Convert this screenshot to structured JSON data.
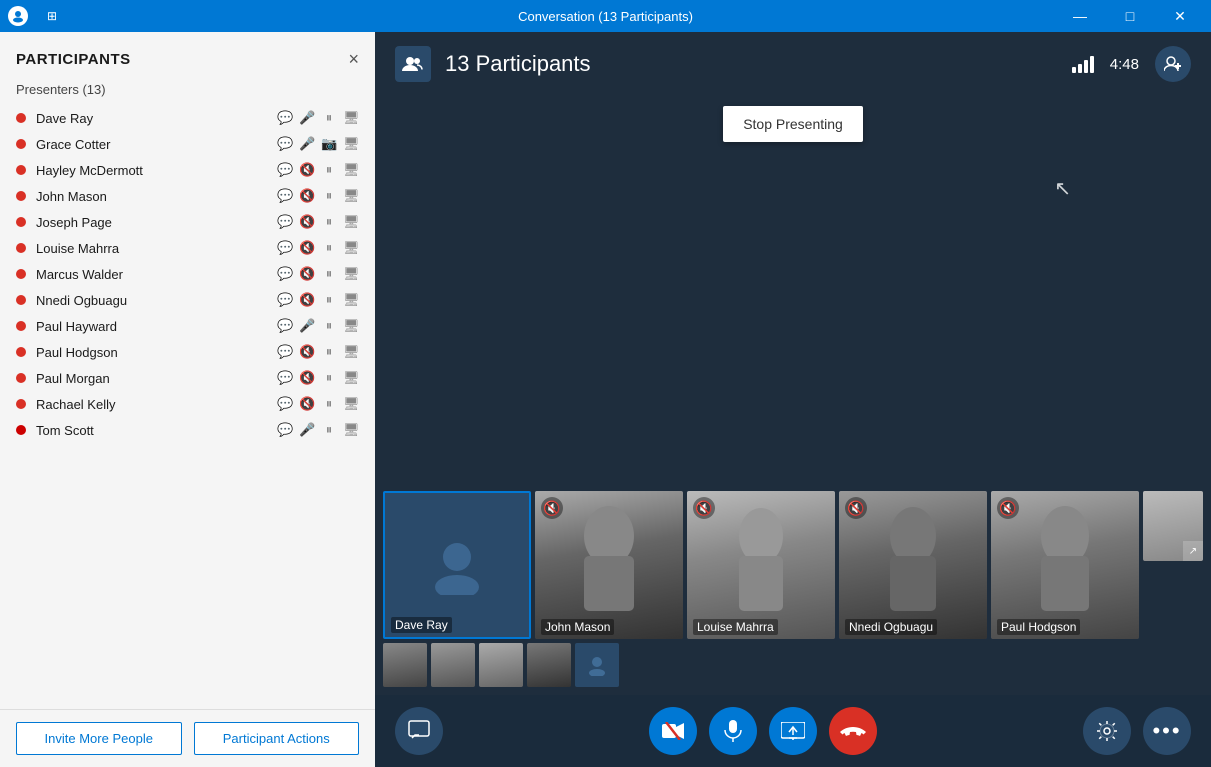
{
  "titleBar": {
    "title": "Conversation (13 Participants)",
    "controls": {
      "minimize": "—",
      "maximize": "□",
      "close": "✕",
      "snap": "⊞",
      "expand": "⛶"
    }
  },
  "sidebar": {
    "title": "PARTICIPANTS",
    "close": "×",
    "presenters_label": "Presenters (13)",
    "participants": [
      {
        "name": "Dave Ray",
        "status": "active"
      },
      {
        "name": "Grace Cotter",
        "status": "active"
      },
      {
        "name": "Hayley McDermott",
        "status": "active"
      },
      {
        "name": "John Mason",
        "status": "active"
      },
      {
        "name": "Joseph Page",
        "status": "active"
      },
      {
        "name": "Louise Mahrra",
        "status": "active"
      },
      {
        "name": "Marcus Walder",
        "status": "active"
      },
      {
        "name": "Nnedi Ogbuagu",
        "status": "active"
      },
      {
        "name": "Paul Hayward",
        "status": "active"
      },
      {
        "name": "Paul Hodgson",
        "status": "active"
      },
      {
        "name": "Paul Morgan",
        "status": "active"
      },
      {
        "name": "Rachael Kelly",
        "status": "active"
      },
      {
        "name": "Tom Scott",
        "status": "active"
      }
    ],
    "invite_btn": "Invite More People",
    "actions_btn": "Participant Actions"
  },
  "header": {
    "participants_count": "13 Participants",
    "timer": "4:48",
    "add_participant_label": "+"
  },
  "presentation": {
    "stop_btn": "Stop Presenting"
  },
  "video_participants": [
    {
      "name": "Dave Ray",
      "muted": false,
      "type": "avatar"
    },
    {
      "name": "John Mason",
      "muted": true,
      "type": "photo"
    },
    {
      "name": "Louise Mahrra",
      "muted": true,
      "type": "photo"
    },
    {
      "name": "Nnedi Ogbuagu",
      "muted": true,
      "type": "photo"
    },
    {
      "name": "Paul Hodgson",
      "muted": true,
      "type": "photo"
    }
  ],
  "toolbar": {
    "message_label": "💬",
    "video_label": "🎥",
    "mic_label": "🎤",
    "screen_label": "🖥",
    "end_label": "📵",
    "settings_label": "⚙",
    "more_label": "···"
  },
  "colors": {
    "accent": "#0078d4",
    "end_call": "#d93025",
    "bg_dark": "#1e2d3d",
    "sidebar_bg": "#f5f5f5"
  }
}
